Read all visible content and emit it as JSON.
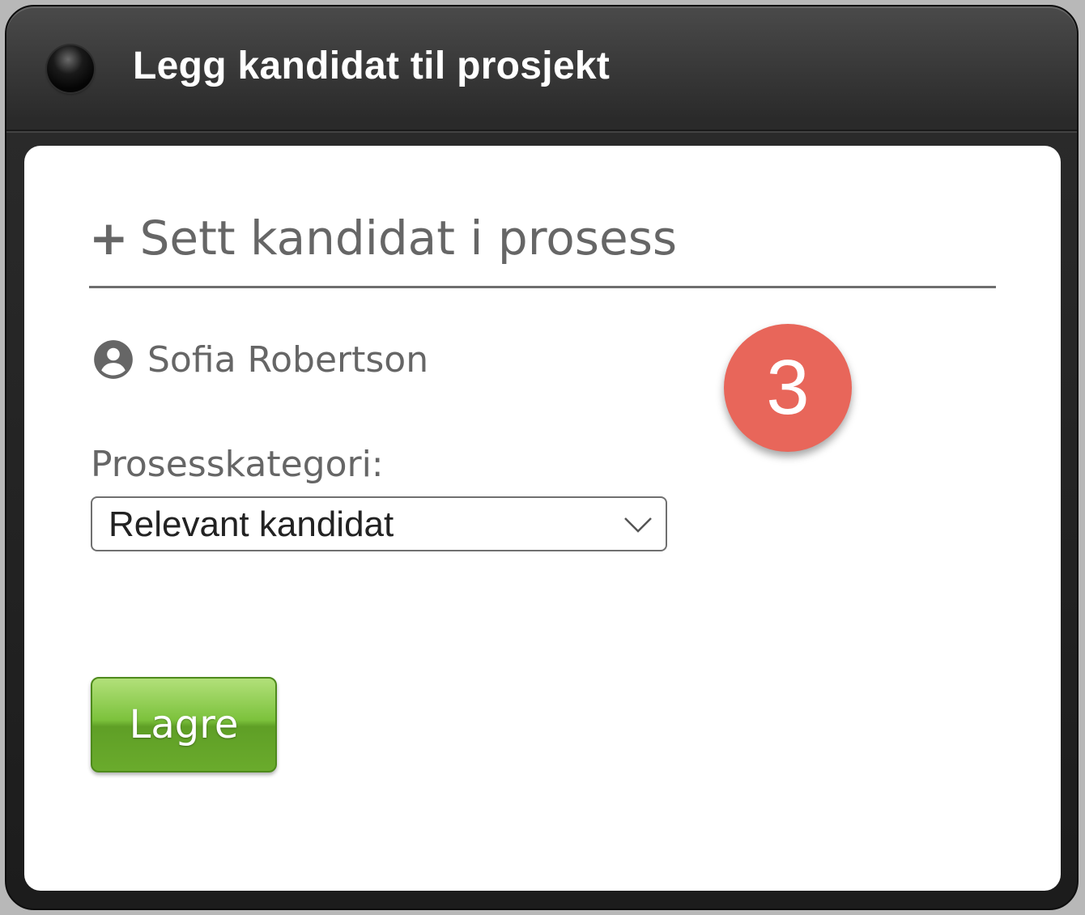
{
  "window": {
    "title": "Legg kandidat til prosjekt"
  },
  "panel": {
    "action_plus": "+",
    "action_label": "Sett kandidat i prosess",
    "candidate_icon": "person-circle-icon",
    "candidate_name": "Sofia Robertson",
    "step_badge": "3",
    "category_label": "Prosesskategori:",
    "category_value": "Relevant kandidat",
    "save_label": "Lagre"
  },
  "colors": {
    "badge": "#e8665a",
    "save_button": "#6aab2c",
    "text_gray": "#666666"
  }
}
